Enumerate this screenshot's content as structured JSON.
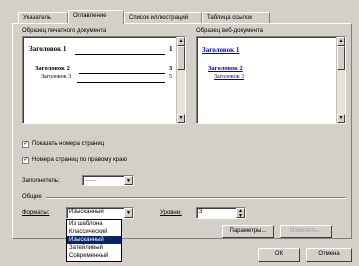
{
  "tabs": [
    {
      "label": "Указатель",
      "active": false
    },
    {
      "label": "Оглавление",
      "active": true
    },
    {
      "label": "Список иллюстраций",
      "active": false
    },
    {
      "label": "Таблица ссылок",
      "active": false
    }
  ],
  "print_preview": {
    "label": "Образец печатного документа",
    "lines": [
      {
        "text": "Заголовок 1",
        "page": "1"
      },
      {
        "text": "Заголовок 2",
        "page": "3"
      },
      {
        "text": "Заголовок 3",
        "page": "5"
      }
    ]
  },
  "web_preview": {
    "label": "Образец веб-документа",
    "links": [
      "Заголовок 1",
      "Заголовок 2",
      "Заголовок 3"
    ]
  },
  "options": {
    "show_page_numbers": {
      "label": "Показать номера страниц",
      "checked": true
    },
    "right_align": {
      "label": "Номера страниц по правому краю",
      "checked": true
    },
    "tab_leader_label": "Заполнитель:",
    "tab_leader_value": "……"
  },
  "general": {
    "label": "Общие",
    "formats_label": "Форматы:",
    "formats_value": "Изысканный",
    "levels_label": "Уровни:",
    "levels_value": "3",
    "formats_options": [
      "Из шаблона",
      "Классический",
      "Изысканный",
      "Затейливый",
      "Современный"
    ],
    "selected_index": 2
  },
  "buttons": {
    "options": "Параметры...",
    "modify": "Изменить...",
    "ok": "ОК",
    "cancel": "Отмена"
  },
  "icons": {
    "dropdown": "▼",
    "up": "▲",
    "down": "▼",
    "check": "✓"
  }
}
